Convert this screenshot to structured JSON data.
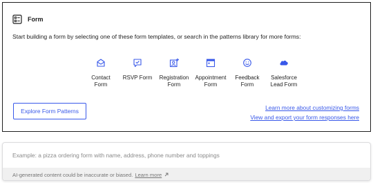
{
  "block": {
    "title": "Form",
    "instructions": "Start building a form by selecting one of these form templates, or search in the patterns library for more forms:"
  },
  "templates": [
    {
      "label": "Contact\nForm",
      "icon": "envelope-icon"
    },
    {
      "label": "RSVP Form",
      "icon": "rsvp-icon"
    },
    {
      "label": "Registration\nForm",
      "icon": "registration-icon"
    },
    {
      "label": "Appointment\nForm",
      "icon": "calendar-icon"
    },
    {
      "label": "Feedback\nForm",
      "icon": "smiley-icon"
    },
    {
      "label": "Salesforce\nLead Form",
      "icon": "salesforce-cloud-icon"
    }
  ],
  "actions": {
    "explore_label": "Explore Form Patterns",
    "learn_more_link": "Learn more about customizing forms",
    "view_responses_link": "View and export your form responses here"
  },
  "prompt": {
    "placeholder": "Example: a pizza ordering form with name, address, phone number and toppings",
    "disclaimer": "AI-generated content could be inaccurate or biased.",
    "learn_more": "Learn more"
  },
  "colors": {
    "accent": "#3858e9",
    "text": "#1e1e1e",
    "muted": "#757575",
    "disclaimer_bg": "#f0f0f0"
  }
}
